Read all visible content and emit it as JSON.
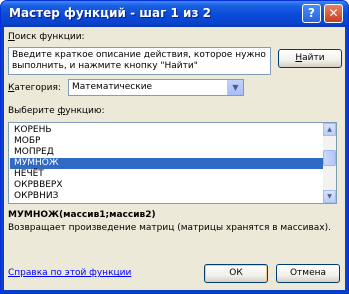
{
  "window": {
    "title": "Мастер функций - шаг 1 из 2",
    "help_button": "?",
    "close_button": "✕"
  },
  "search": {
    "label_first": "П",
    "label_rest": "оиск функции:",
    "text_line1": "Введите краткое описание действия, которое нужно",
    "text_line2": "выполнить, и нажмите кнопку \"Найти\"",
    "find_button_first": "Н",
    "find_button_rest": "айти"
  },
  "category": {
    "label_first": "К",
    "label_rest": "атегория:",
    "selected": "Математические"
  },
  "functions": {
    "label_prefix": "Выберите ",
    "label_underlined": "ф",
    "label_suffix": "ункцию:",
    "items": [
      "КОРЕНЬ",
      "МОБР",
      "МОПРЕД",
      "МУМНОЖ",
      "НЕЧЁТ",
      "ОКРВВЕРХ",
      "ОКРВНИЗ"
    ],
    "selected_index": 3
  },
  "description": {
    "signature": "МУМНОЖ(массив1;массив2)",
    "text": "Возвращает произведение матриц (матрицы хранятся в массивах)."
  },
  "footer": {
    "help_link": "Справка по этой функции",
    "ok_button": "ОК",
    "cancel_button": "Отмена"
  },
  "colors": {
    "title_bar": "#0a49d8",
    "dialog_bg": "#ece9d8",
    "selection": "#316ac5",
    "link": "#0000ff"
  }
}
